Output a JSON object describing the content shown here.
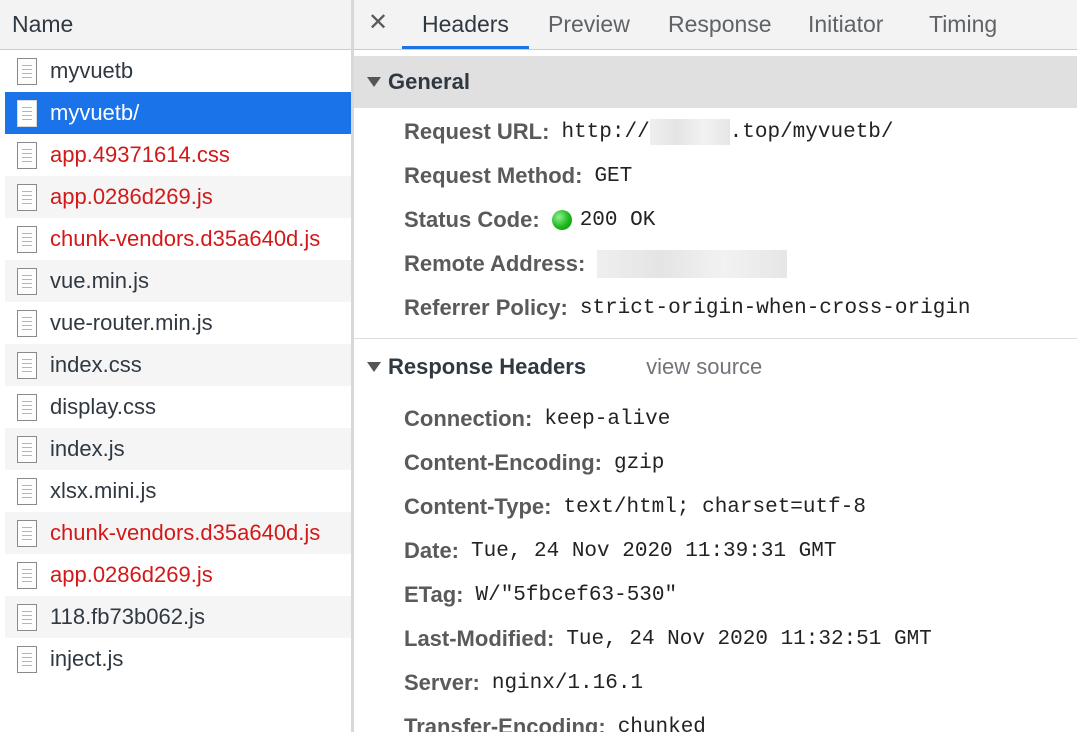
{
  "network_list": {
    "header": "Name",
    "files": [
      {
        "name": "myvuetb",
        "state": "normal"
      },
      {
        "name": "myvuetb/",
        "state": "selected"
      },
      {
        "name": "app.49371614.css",
        "state": "error"
      },
      {
        "name": "app.0286d269.js",
        "state": "error"
      },
      {
        "name": "chunk-vendors.d35a640d.js",
        "state": "error"
      },
      {
        "name": "vue.min.js",
        "state": "normal"
      },
      {
        "name": "vue-router.min.js",
        "state": "normal"
      },
      {
        "name": "index.css",
        "state": "normal"
      },
      {
        "name": "display.css",
        "state": "normal"
      },
      {
        "name": "index.js",
        "state": "normal"
      },
      {
        "name": "xlsx.mini.js",
        "state": "normal"
      },
      {
        "name": "chunk-vendors.d35a640d.js",
        "state": "error"
      },
      {
        "name": "app.0286d269.js",
        "state": "error"
      },
      {
        "name": "118.fb73b062.js",
        "state": "normal"
      },
      {
        "name": "inject.js",
        "state": "normal"
      }
    ]
  },
  "tabs": {
    "close_label": "✕",
    "items": [
      "Headers",
      "Preview",
      "Response",
      "Initiator",
      "Timing"
    ],
    "active": "Headers"
  },
  "general": {
    "title": "General",
    "request_url_key": "Request URL:",
    "request_url_prefix": "http://",
    "request_url_suffix": ".top/myvuetb/",
    "request_method_key": "Request Method:",
    "request_method": "GET",
    "status_code_key": "Status Code:",
    "status_code": "200 OK",
    "remote_address_key": "Remote Address:",
    "referrer_policy_key": "Referrer Policy:",
    "referrer_policy": "strict-origin-when-cross-origin"
  },
  "response_headers": {
    "title": "Response Headers",
    "view_source": "view source",
    "rows": [
      {
        "key": "Connection:",
        "value": "keep-alive"
      },
      {
        "key": "Content-Encoding:",
        "value": "gzip"
      },
      {
        "key": "Content-Type:",
        "value": "text/html; charset=utf-8"
      },
      {
        "key": "Date:",
        "value": "Tue, 24 Nov 2020 11:39:31 GMT"
      },
      {
        "key": "ETag:",
        "value": "W/\"5fbcef63-530\""
      },
      {
        "key": "Last-Modified:",
        "value": "Tue, 24 Nov 2020 11:32:51 GMT"
      },
      {
        "key": "Server:",
        "value": "nginx/1.16.1"
      },
      {
        "key": "Transfer-Encoding:",
        "value": "chunked"
      }
    ]
  },
  "colors": {
    "selected_row": "#1a73e8",
    "error_text": "#d21919",
    "status_ok": "#1db81d"
  }
}
